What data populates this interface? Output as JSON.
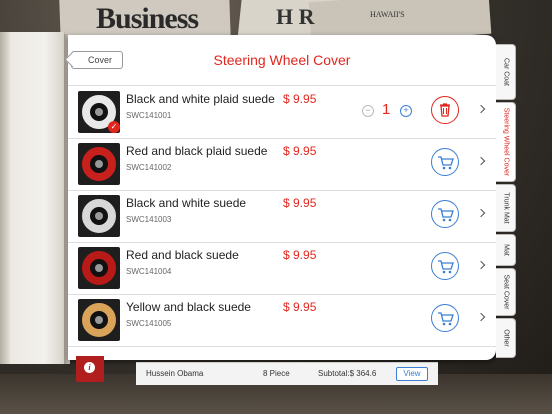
{
  "background": {
    "newspaper_headline": "Business",
    "newspaper_letters": "H  R",
    "newspaper_small": "HAWAII'S"
  },
  "header": {
    "back_label": "Cover",
    "title": "Steering Wheel Cover"
  },
  "products": [
    {
      "name": "Black and white plaid suede",
      "sku": "SWC141001",
      "price": "$ 9.95",
      "in_cart": true,
      "quantity": "1",
      "minus": "−",
      "plus": "+",
      "rim_color": "#e9e9e9"
    },
    {
      "name": "Red and black plaid suede",
      "sku": "SWC141002",
      "price": "$ 9.95",
      "in_cart": false,
      "rim_color": "#c8201c"
    },
    {
      "name": "Black and white suede",
      "sku": "SWC141003",
      "price": "$ 9.95",
      "in_cart": false,
      "rim_color": "#d8d8d8"
    },
    {
      "name": "Red and black suede",
      "sku": "SWC141004",
      "price": "$ 9.95",
      "in_cart": false,
      "rim_color": "#b81a18"
    },
    {
      "name": "Yellow and black suede",
      "sku": "SWC141005",
      "price": "$ 9.95",
      "in_cart": false,
      "rim_color": "#d9a45a"
    }
  ],
  "tabs": [
    {
      "label": "Car Coat",
      "active": false
    },
    {
      "label": "Steering Wheel Cover",
      "active": true
    },
    {
      "label": "Trunk Mat",
      "active": false
    },
    {
      "label": "Mat",
      "active": false
    },
    {
      "label": "Seat Cover",
      "active": false
    },
    {
      "label": "Other",
      "active": false
    }
  ],
  "bottom_bar": {
    "customer": "Hussein Obama",
    "pieces": "8 Piece",
    "subtotal": "Subtotal:$ 364.6",
    "view_label": "View",
    "info_icon": "i"
  },
  "colors": {
    "accent_red": "#e0261d",
    "accent_blue": "#3a7fd5"
  },
  "icons": {
    "delete": "trash-icon",
    "add_to_cart": "cart-icon",
    "row_arrow": "chevron-right-icon",
    "in_cart_mark": "check-icon"
  }
}
